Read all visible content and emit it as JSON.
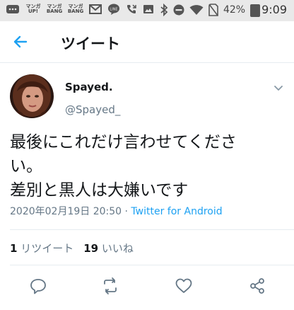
{
  "status_bar": {
    "icons": [
      "notification-icon",
      "manga-app-icon",
      "manga-bang-icon",
      "manga-bang-icon",
      "gmail-icon",
      "line-icon",
      "missed-call-icon",
      "image-icon",
      "bluetooth-icon",
      "do-not-disturb-icon",
      "wifi-icon",
      "no-sim-icon",
      "battery-icon"
    ],
    "manga_labels": [
      {
        "top": "マンガ",
        "bottom": "UP!"
      },
      {
        "top": "マンガ",
        "bottom": "BANG"
      },
      {
        "top": "マンガ",
        "bottom": "BANG"
      }
    ],
    "battery": "42%",
    "time": "9:09"
  },
  "header": {
    "title": "ツイート",
    "back_icon": "back-arrow-icon"
  },
  "tweet": {
    "display_name": "Spayed.",
    "username": "@Spayed_",
    "text_lines": [
      "最後にこれだけ言わせてくださ",
      "い。",
      "差別と黒人は大嫌いです"
    ],
    "timestamp": "2020年02月19日 20:50",
    "separator": " · ",
    "source": "Twitter for Android",
    "retweets": {
      "count": "1",
      "label": "リツイート"
    },
    "likes": {
      "count": "19",
      "label": "いいね"
    }
  },
  "actions": [
    "reply-icon",
    "retweet-icon",
    "like-icon",
    "share-icon"
  ],
  "colors": {
    "accent": "#1da1f2",
    "secondary_text": "#657786",
    "border": "#e6ecf0"
  }
}
